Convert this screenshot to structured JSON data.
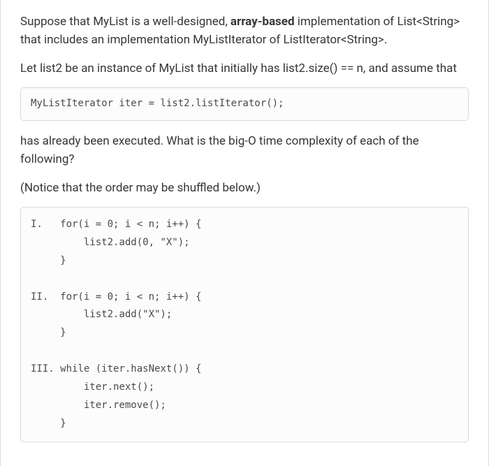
{
  "para1_parts": {
    "pre": "Suppose that MyList is a well-designed, ",
    "bold": "array-based",
    "post": " implementation of List<String> that includes an implementation MyListIterator of ListIterator<String>."
  },
  "para2": "Let list2 be an instance of MyList that initially has list2.size() == n, and assume that",
  "code1": "MyListIterator iter = list2.listIterator();",
  "para3": "has already been executed. What is the big-O time complexity of each of the following?",
  "para4": "(Notice that the order may be shuffled below.)",
  "code2": "I.   for(i = 0; i < n; i++) {\n         list2.add(0, \"X\");\n     }\n\nII.  for(i = 0; i < n; i++) {\n         list2.add(\"X\");\n     }\n\nIII. while (iter.hasNext()) {\n         iter.next();\n         iter.remove();\n     }"
}
